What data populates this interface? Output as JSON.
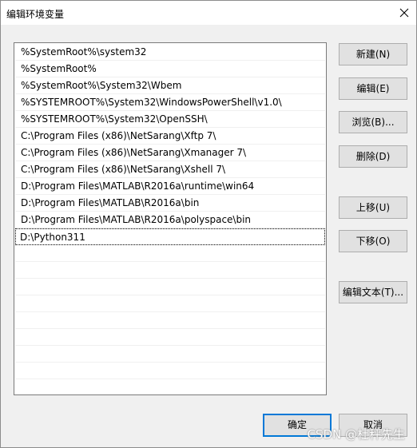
{
  "window": {
    "title": "编辑环境变量",
    "close_icon": "close-icon"
  },
  "path_list": {
    "items": [
      "%SystemRoot%\\system32",
      "%SystemRoot%",
      "%SystemRoot%\\System32\\Wbem",
      "%SYSTEMROOT%\\System32\\WindowsPowerShell\\v1.0\\",
      "%SYSTEMROOT%\\System32\\OpenSSH\\",
      "C:\\Program Files (x86)\\NetSarang\\Xftp 7\\",
      "C:\\Program Files (x86)\\NetSarang\\Xmanager 7\\",
      "C:\\Program Files (x86)\\NetSarang\\Xshell 7\\",
      "D:\\Program Files\\MATLAB\\R2016a\\runtime\\win64",
      "D:\\Program Files\\MATLAB\\R2016a\\bin",
      "D:\\Program Files\\MATLAB\\R2016a\\polyspace\\bin",
      "D:\\Python311",
      "",
      "",
      "",
      "",
      "",
      "",
      "",
      "",
      ""
    ],
    "selected_index": 11
  },
  "buttons": {
    "new": "新建(N)",
    "edit": "编辑(E)",
    "browse": "浏览(B)...",
    "delete": "删除(D)",
    "move_up": "上移(U)",
    "move_down": "下移(O)",
    "edit_text": "编辑文本(T)...",
    "ok": "确定",
    "cancel": "取消"
  },
  "watermark": "CSDN @杜秤先生",
  "colors": {
    "dialog_bg": "#f0f0f0",
    "button_bg": "#e1e1e1",
    "default_button_border": "#0078d7"
  }
}
